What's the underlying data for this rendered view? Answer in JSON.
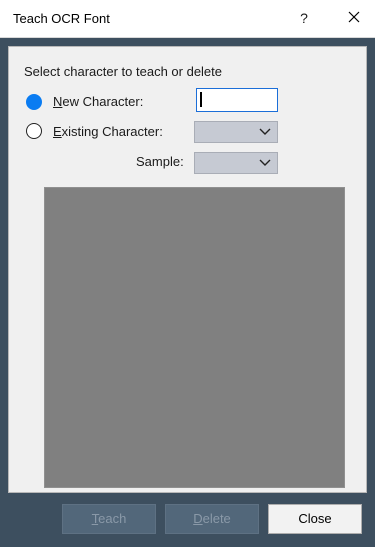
{
  "window": {
    "title": "Teach OCR Font",
    "help_glyph": "?"
  },
  "form": {
    "group_label": "Select character to teach or delete",
    "new_character": {
      "accesskey": "N",
      "label_rest": "ew Character:",
      "selected": true,
      "value": ""
    },
    "existing_character": {
      "accesskey": "E",
      "label_rest": "xisting Character:",
      "selected": false,
      "value": ""
    },
    "sample": {
      "label": "Sample:",
      "value": ""
    }
  },
  "buttons": {
    "teach": {
      "accesskey": "T",
      "rest": "each",
      "enabled": false
    },
    "delete": {
      "accesskey": "D",
      "rest": "elete",
      "enabled": false
    },
    "close": {
      "label": "Close",
      "enabled": true
    }
  }
}
